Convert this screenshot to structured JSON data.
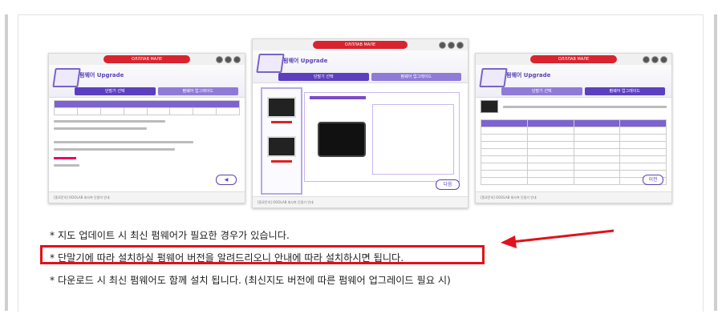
{
  "screenshots": {
    "left": {
      "title_bar": "ОЛЛЛАВ МАЛЕ",
      "heading": "펌웨어 Upgrade",
      "steps": [
        "단말기 선택",
        "펌웨어 업그레이드"
      ],
      "footer": "[종료문의] OOOLAB 회사측 단말의 안내"
    },
    "center": {
      "title_bar": "ОЛЛЛАВ МАЛЕ",
      "heading": "펌웨어 Upgrade",
      "steps": [
        "단말기 선택",
        "펌웨어 업그레이드"
      ],
      "ok_label": "다음",
      "footer": "[종료문의] OOOLAB 회사측 단말기 안내"
    },
    "right": {
      "title_bar": "ОЛЛЛАВ МАЛЕ",
      "heading": "펌웨어 Upgrade",
      "steps": [
        "단말기 선택",
        "펌웨어 업그레이드"
      ],
      "ok_label": "이전",
      "footer": "[종료문의] OOOLAB 회사측 단말기 안내"
    }
  },
  "notes": [
    "* 지도 업데이트 시 최신 펌웨어가 필요한 경우가 있습니다.",
    "* 단말기에 따라 설치하실 펌웨어 버전을 알려드리오니 안내에 따라 설치하시면 됩니다.",
    "* 다운로드 시 최신 펌웨어도 함께 설치 됩니다. (최신지도 버전에 따른 펌웨어 업그레이드 필요 시)"
  ],
  "colors": {
    "highlight": "#e0121a",
    "accent": "#5c3fbf"
  }
}
